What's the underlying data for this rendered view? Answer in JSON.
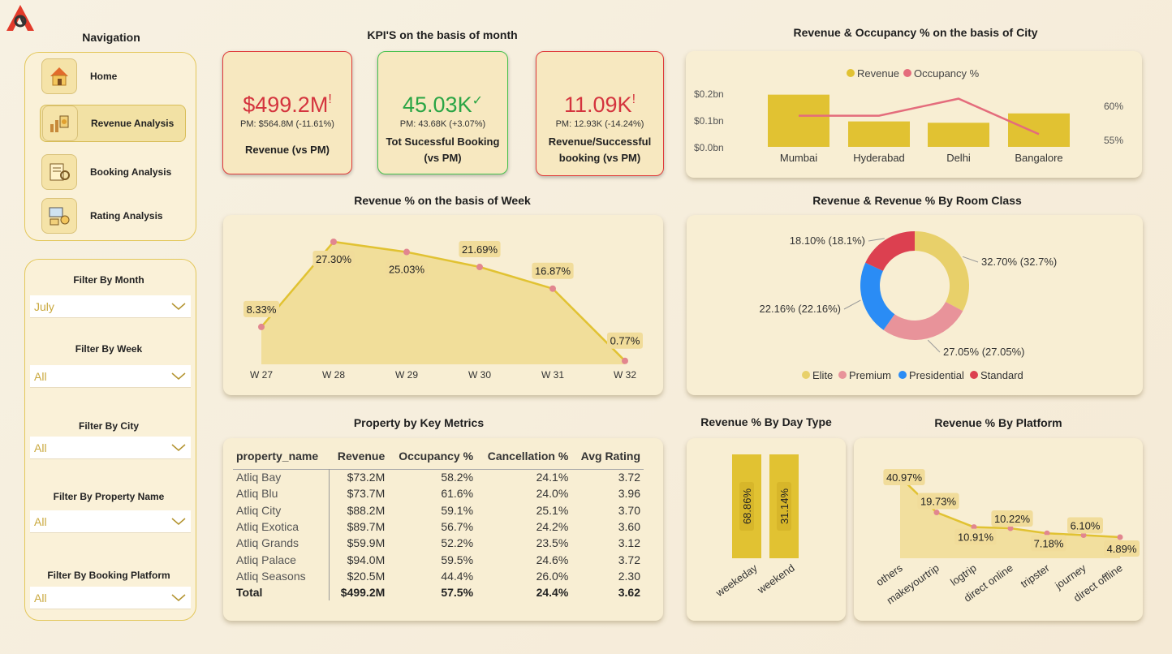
{
  "nav": {
    "title": "Navigation",
    "items": [
      {
        "label": "Home",
        "icon": "home-icon"
      },
      {
        "label": "Revenue Analysis",
        "icon": "revenue-analysis-icon",
        "active": true
      },
      {
        "label": "Booking Analysis",
        "icon": "booking-analysis-icon"
      },
      {
        "label": "Rating Analysis",
        "icon": "rating-analysis-icon"
      }
    ]
  },
  "filters": [
    {
      "label": "Filter By Month",
      "value": "July"
    },
    {
      "label": "Filter By Week",
      "value": "All"
    },
    {
      "label": "Filter By City",
      "value": "All"
    },
    {
      "label": "Filter By Property Name",
      "value": "All"
    },
    {
      "label": "Filter By Booking Platform",
      "value": "All"
    }
  ],
  "kpis": {
    "title": "KPI'S on the basis of month",
    "cards": [
      {
        "value": "$499.2M",
        "marker": "!",
        "sub": "PM: $564.8M (-11.61%)",
        "label": "Revenue (vs PM)",
        "status": "bad"
      },
      {
        "value": "45.03K",
        "marker": "✓",
        "sub": "PM: 43.68K (+3.07%)",
        "label": "Tot Sucessful Booking (vs PM)",
        "status": "good"
      },
      {
        "value": "11.09K",
        "marker": "!",
        "sub": "PM: 12.93K (-14.24%)",
        "label": "Revenue/Successful booking (vs PM)",
        "status": "bad"
      }
    ]
  },
  "colors": {
    "gold": "#e1c232",
    "pink": "#e46c7c",
    "red_text": "#d4343e",
    "green_text": "#2aa545",
    "red_border": "#e03a3a",
    "green_border": "#47c24d",
    "elite": "#e8d06a",
    "premium": "#e8939a",
    "presidential": "#2a8cf5",
    "standard": "#dc4050"
  },
  "city_chart": {
    "title": "Revenue & Occupancy % on the basis of City",
    "legend": [
      "Revenue",
      "Occupancy %"
    ],
    "y_left_ticks": [
      "$0.2bn",
      "$0.1bn",
      "$0.0bn"
    ],
    "y_right_ticks": [
      "60%",
      "55%"
    ],
    "chart_data": {
      "type": "bar",
      "categories": [
        "Mumbai",
        "Hyderabad",
        "Delhi",
        "Bangalore"
      ],
      "series": [
        {
          "name": "Revenue",
          "values": [
            0.195,
            0.095,
            0.09,
            0.125
          ],
          "unit": "bn"
        },
        {
          "name": "Occupancy %",
          "values": [
            58.5,
            58.5,
            61.0,
            55.8
          ]
        }
      ],
      "ylim_left": [
        0,
        0.2
      ],
      "ylim_right": [
        55,
        60
      ]
    }
  },
  "week_chart": {
    "title": "Revenue % on the basis of Week",
    "chart_data": {
      "type": "area",
      "categories": [
        "W 27",
        "W 28",
        "W 29",
        "W 30",
        "W 31",
        "W 32"
      ],
      "values": [
        8.33,
        27.3,
        25.03,
        21.69,
        16.87,
        0.77
      ],
      "labels": [
        "8.33%",
        "27.30%",
        "25.03%",
        "21.69%",
        "16.87%",
        "0.77%"
      ]
    }
  },
  "room_chart": {
    "title": "Revenue & Revenue % By Room Class",
    "chart_data": {
      "type": "pie",
      "categories": [
        "Elite",
        "Premium",
        "Presidential",
        "Standard"
      ],
      "values": [
        32.7,
        27.05,
        22.16,
        18.1
      ],
      "labels": [
        "32.70% (32.7%)",
        "27.05% (27.05%)",
        "22.16% (22.16%)",
        "18.10% (18.1%)"
      ]
    }
  },
  "property_table": {
    "title": "Property by Key Metrics",
    "headers": [
      "property_name",
      "Revenue",
      "Occupancy %",
      "Cancellation %",
      "Avg Rating"
    ],
    "rows": [
      [
        "Atliq Bay",
        "$73.2M",
        "58.2%",
        "24.1%",
        "3.72"
      ],
      [
        "Atliq Blu",
        "$73.7M",
        "61.6%",
        "24.0%",
        "3.96"
      ],
      [
        "Atliq City",
        "$88.2M",
        "59.1%",
        "25.1%",
        "3.70"
      ],
      [
        "Atliq Exotica",
        "$89.7M",
        "56.7%",
        "24.2%",
        "3.60"
      ],
      [
        "Atliq Grands",
        "$59.9M",
        "52.2%",
        "23.5%",
        "3.12"
      ],
      [
        "Atliq Palace",
        "$94.0M",
        "59.5%",
        "24.6%",
        "3.72"
      ],
      [
        "Atliq Seasons",
        "$20.5M",
        "44.4%",
        "26.0%",
        "2.30"
      ]
    ],
    "total": [
      "Total",
      "$499.2M",
      "57.5%",
      "24.4%",
      "3.62"
    ]
  },
  "daytype_chart": {
    "title": "Revenue % By Day Type",
    "chart_data": {
      "type": "bar",
      "categories": [
        "weekeday",
        "weekend"
      ],
      "values": [
        68.86,
        31.14
      ],
      "labels": [
        "68.86%",
        "31.14%"
      ]
    }
  },
  "platform_chart": {
    "title": "Revenue % By Platform",
    "chart_data": {
      "type": "area",
      "categories": [
        "others",
        "makeyourtrip",
        "logtrip",
        "direct online",
        "tripster",
        "journey",
        "direct offline"
      ],
      "values": [
        40.97,
        19.73,
        10.91,
        10.22,
        7.18,
        6.1,
        4.89
      ],
      "labels": [
        "40.97%",
        "19.73%",
        "10.91%",
        "10.22%",
        "7.18%",
        "6.10%",
        "4.89%"
      ]
    }
  }
}
